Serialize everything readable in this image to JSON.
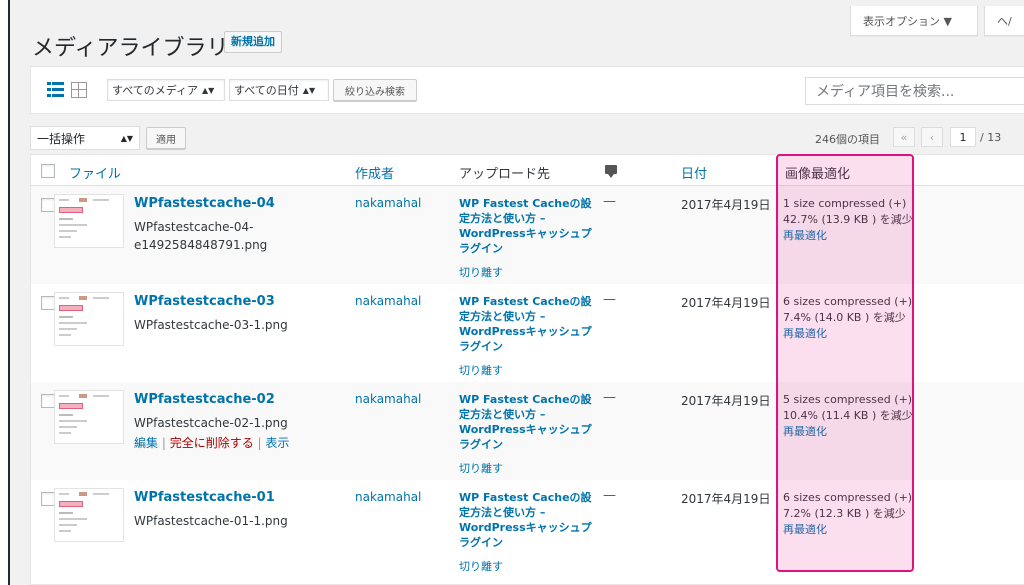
{
  "screen_options": {
    "screen_label": "表示オプション ▼",
    "help_label": "ヘ/"
  },
  "header": {
    "title": "メディアライブラリ",
    "add_new": "新規追加"
  },
  "filters": {
    "media_type": "すべてのメディア",
    "dates": "すべての日付",
    "filter_button": "絞り込み検索",
    "search_placeholder": "メディア項目を検索..."
  },
  "tablenav": {
    "bulk_action": "一括操作",
    "apply": "適用",
    "items_count": "246個の項目",
    "first_page": "«",
    "prev_page": "‹",
    "current_page": "1",
    "total_pages": "/ 13"
  },
  "columns": {
    "file": "ファイル",
    "author": "作成者",
    "uploaded_to": "アップロード先",
    "date": "日付",
    "optimization": "画像最適化"
  },
  "rows": [
    {
      "title": "WPfastestcache-04",
      "filename": "WPfastestcache-04-e1492584848791.png",
      "author": "nakamahal",
      "uploaded_to": "WP Fastest Cacheの設定方法と使い方 – WordPressキャッシュプラグイン",
      "detach": "切り離す",
      "comments": "—",
      "date": "2017年4月19日",
      "opt_line1": "1 size compressed (+)",
      "opt_line2": "42.7% (13.9 KB ) を減少",
      "reoptimize": "再最適化"
    },
    {
      "title": "WPfastestcache-03",
      "filename": "WPfastestcache-03-1.png",
      "author": "nakamahal",
      "uploaded_to": "WP Fastest Cacheの設定方法と使い方 – WordPressキャッシュプラグイン",
      "detach": "切り離す",
      "comments": "—",
      "date": "2017年4月19日",
      "opt_line1": "6 sizes compressed (+)",
      "opt_line2": "7.4% (14.0 KB ) を減少",
      "reoptimize": "再最適化"
    },
    {
      "title": "WPfastestcache-02",
      "filename": "WPfastestcache-02-1.png",
      "author": "nakamahal",
      "uploaded_to": "WP Fastest Cacheの設定方法と使い方 – WordPressキャッシュプラグイン",
      "detach": "切り離す",
      "comments": "—",
      "date": "2017年4月19日",
      "opt_line1": "5 sizes compressed (+)",
      "opt_line2": "10.4% (11.4 KB ) を減少",
      "reoptimize": "再最適化",
      "actions": {
        "edit": "編集",
        "delete": "完全に削除する",
        "view": "表示"
      }
    },
    {
      "title": "WPfastestcache-01",
      "filename": "WPfastestcache-01-1.png",
      "author": "nakamahal",
      "uploaded_to": "WP Fastest Cacheの設定方法と使い方 – WordPressキャッシュプラグイン",
      "detach": "切り離す",
      "comments": "—",
      "date": "2017年4月19日",
      "opt_line1": "6 sizes compressed (+)",
      "opt_line2": "7.2% (12.3 KB ) を減少",
      "reoptimize": "再最適化"
    }
  ],
  "colors": {
    "link": "#0073aa",
    "highlight": "#e0127f",
    "delete": "#aa0000"
  }
}
